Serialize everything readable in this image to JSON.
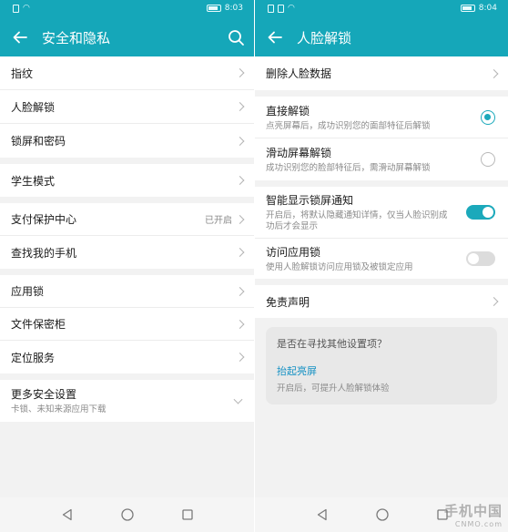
{
  "left": {
    "status": {
      "time": "8:03"
    },
    "title": "安全和隐私",
    "groups": [
      [
        {
          "label": "指纹"
        },
        {
          "label": "人脸解锁"
        },
        {
          "label": "锁屏和密码"
        }
      ],
      [
        {
          "label": "学生模式"
        }
      ],
      [
        {
          "label": "支付保护中心",
          "value": "已开启"
        },
        {
          "label": "查找我的手机"
        }
      ],
      [
        {
          "label": "应用锁"
        },
        {
          "label": "文件保密柜"
        },
        {
          "label": "定位服务"
        }
      ],
      [
        {
          "label": "更多安全设置",
          "sub": "卡锁、未知来源应用下载"
        }
      ]
    ]
  },
  "right": {
    "status": {
      "time": "8:04"
    },
    "title": "人脸解锁",
    "delete_label": "删除人脸数据",
    "unlock_options": [
      {
        "label": "直接解锁",
        "sub": "点亮屏幕后，成功识别您的面部特征后解锁",
        "selected": true
      },
      {
        "label": "滑动屏幕解锁",
        "sub": "成功识别您的脸部特征后，需滑动屏幕解锁",
        "selected": false
      }
    ],
    "toggles": [
      {
        "label": "智能显示锁屏通知",
        "sub": "开启后，将默认隐藏通知详情，仅当人脸识别成功后才会显示",
        "on": true
      },
      {
        "label": "访问应用锁",
        "sub": "使用人脸解锁访问应用锁及被锁定应用",
        "on": false
      }
    ],
    "disclaimer_label": "免责声明",
    "tip": {
      "question": "是否在寻找其他设置项？",
      "link": "抬起亮屏",
      "desc": "开启后，可提升人脸解锁体验"
    }
  },
  "watermark": {
    "cn": "手机中国",
    "en": "CNMO.com"
  },
  "colors": {
    "accent": "#15a7b9",
    "link": "#1591c4"
  }
}
